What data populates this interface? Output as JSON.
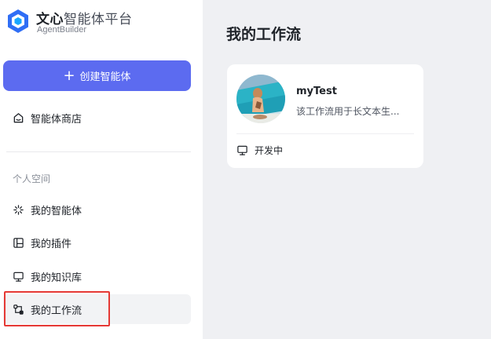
{
  "sidebar": {
    "logo": {
      "title_bold": "文心",
      "title_rest": "智能体平台",
      "subtitle": "AgentBuilder"
    },
    "create_button": {
      "icon": "plus-icon",
      "label": "创建智能体"
    },
    "store": {
      "icon": "store-icon",
      "label": "智能体商店"
    },
    "section_title": "个人空间",
    "items": [
      {
        "icon": "sparkle-icon",
        "label": "我的智能体"
      },
      {
        "icon": "plugin-icon",
        "label": "我的插件"
      },
      {
        "icon": "monitor-icon",
        "label": "我的知识库"
      },
      {
        "icon": "workflow-icon",
        "label": "我的工作流",
        "active": true
      }
    ]
  },
  "main": {
    "title": "我的工作流",
    "workflows": [
      {
        "name": "myTest",
        "description": "该工作流用于长文本生...",
        "status_icon": "monitor-icon",
        "status": "开发中"
      }
    ]
  },
  "colors": {
    "accent": "#5c6bf0",
    "highlight": "#e53935",
    "background": "#eff0f3"
  }
}
